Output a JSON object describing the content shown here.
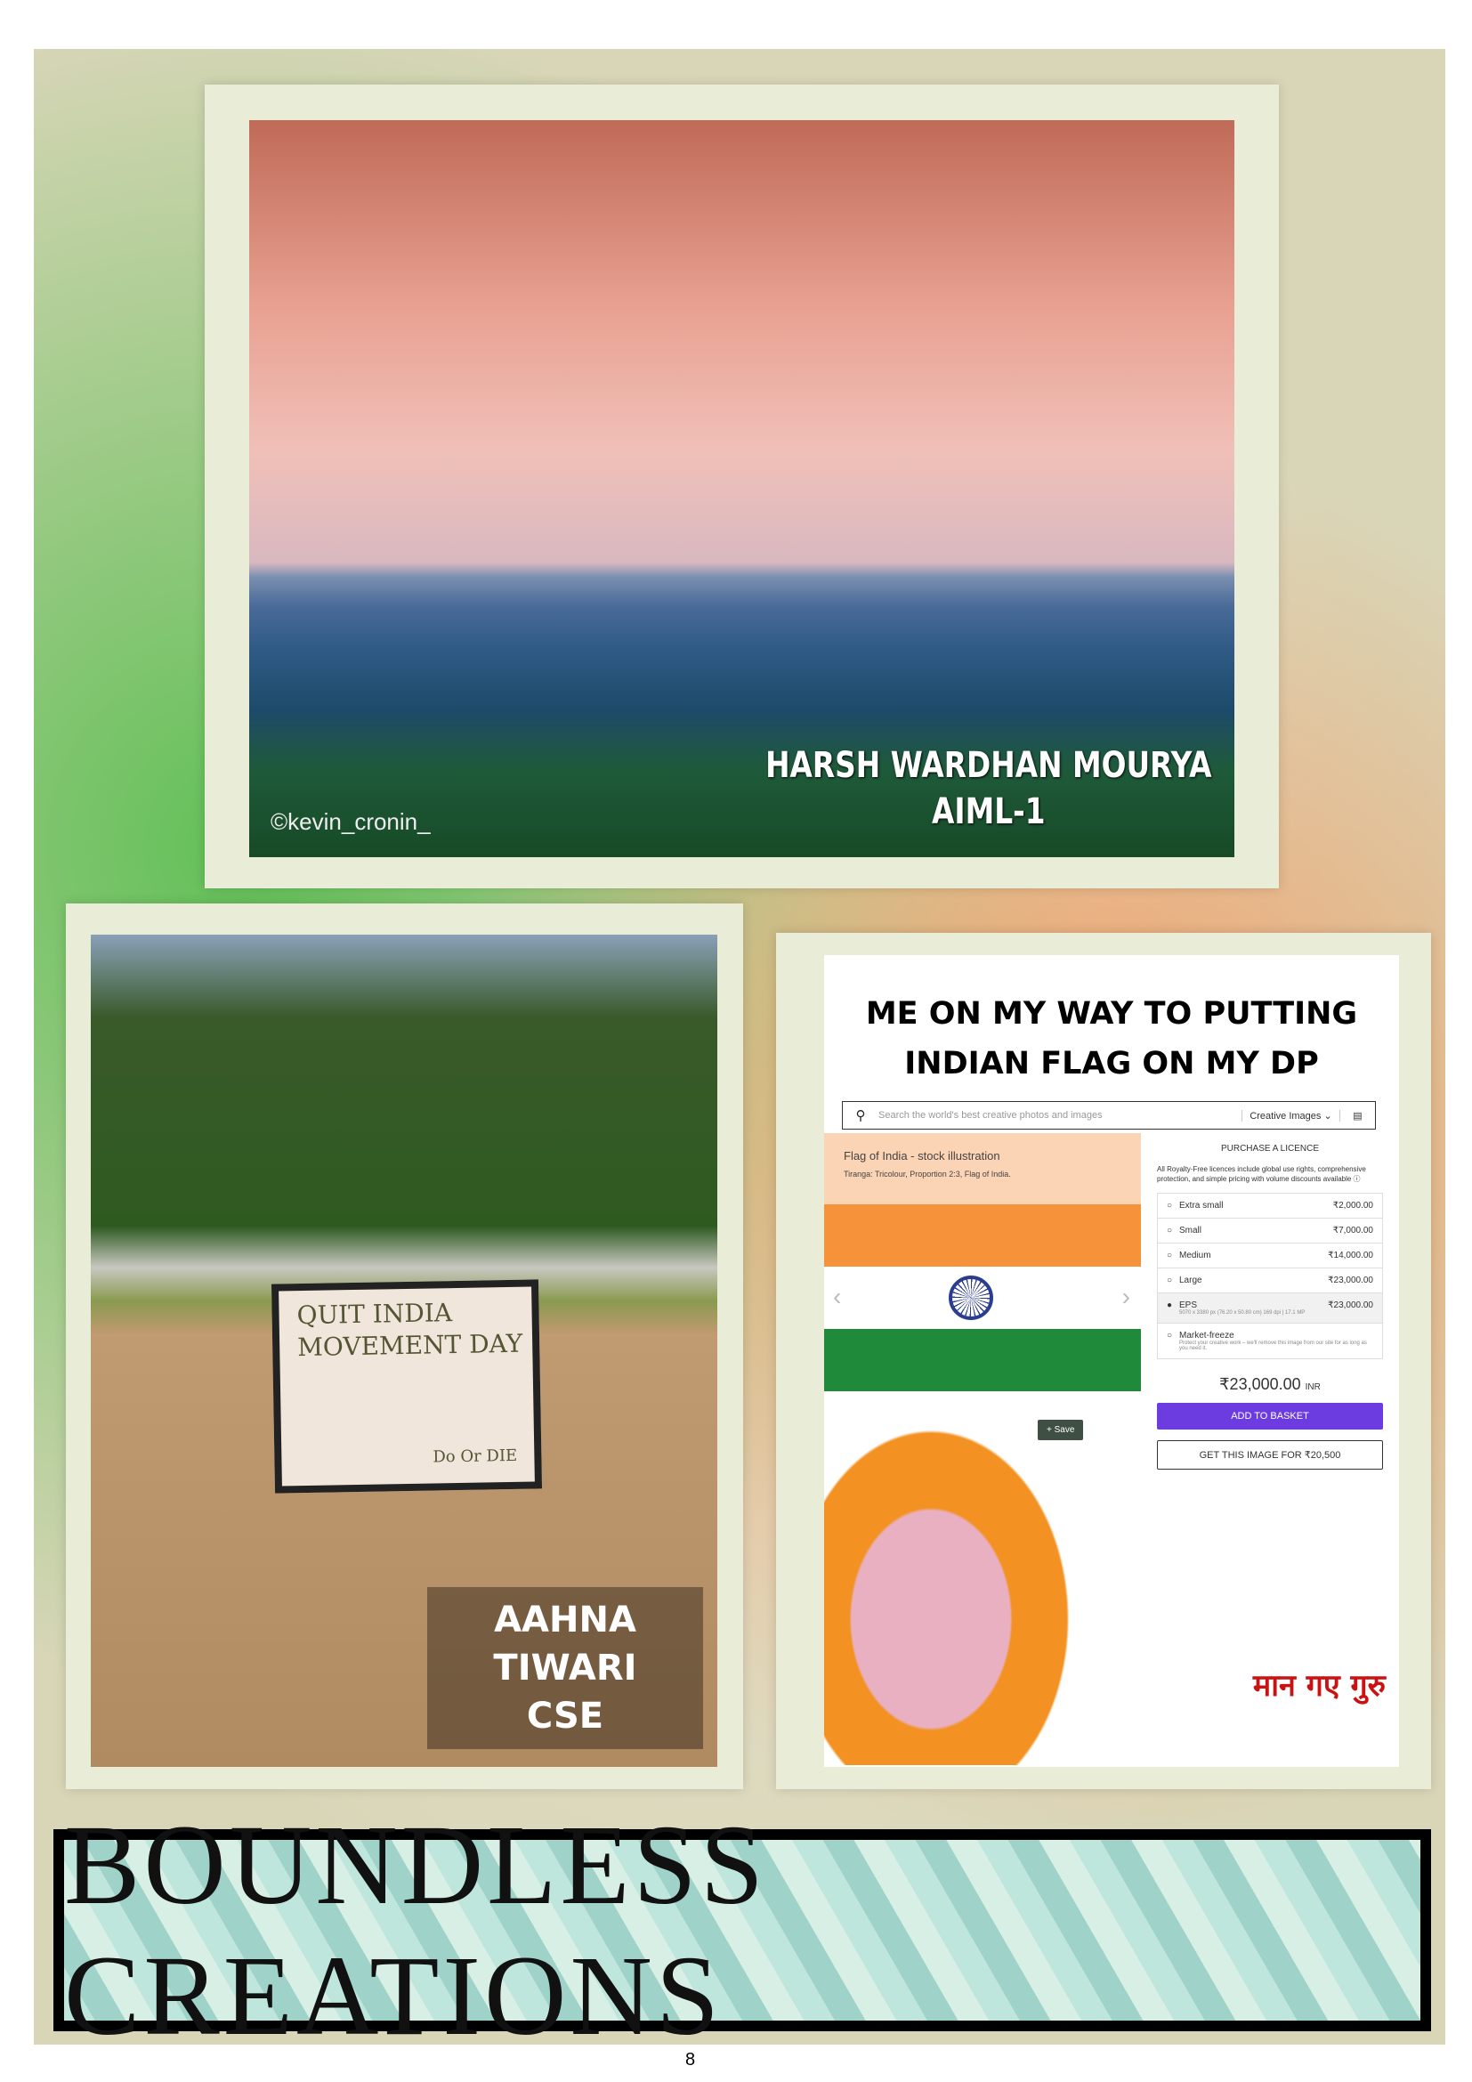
{
  "photo1": {
    "credit": "©kevin_cronin_",
    "author": "HARSH WARDHAN MOURYA",
    "dept": "AIML-1"
  },
  "photo2": {
    "poster_line1": "QUIT INDIA",
    "poster_line2": "MOVEMENT DAY",
    "poster_slogan": "Do Or DIE",
    "author": "AAHNA TIWARI",
    "dept": "CSE"
  },
  "meme": {
    "heading_line1": "ME ON MY WAY TO PUTTING",
    "heading_line2": "INDIAN FLAG ON MY DP",
    "search_placeholder": "Search the world's best creative photos and images",
    "category": "Creative Images ⌄",
    "title": "Flag of India - stock illustration",
    "subtitle": "Tiranga: Tricolour, Proportion 2:3, Flag of India.",
    "save": "+ Save",
    "purchase_title": "PURCHASE A LICENCE",
    "purchase_desc": "All Royalty-Free licences include global use rights, comprehensive protection, and simple pricing with volume discounts available ⓘ",
    "options": [
      {
        "name": "Extra small",
        "price": "₹2,000.00"
      },
      {
        "name": "Small",
        "price": "₹7,000.00"
      },
      {
        "name": "Medium",
        "price": "₹14,000.00"
      },
      {
        "name": "Large",
        "price": "₹23,000.00"
      },
      {
        "name": "EPS",
        "price": "₹23,000.00",
        "detail": "5070 x 3380 px (76.20 x 50.80 cm) 169 dpi | 17.1 MP",
        "selected": true
      },
      {
        "name": "Market-freeze",
        "price": "",
        "detail": "Protect your creative work – we'll remove this image from our site for as long as you need it."
      }
    ],
    "total": "₹23,000.00",
    "currency": "INR",
    "add_to_basket": "ADD TO BASKET",
    "get_image": "GET THIS IMAGE FOR ₹20,500",
    "hindi_caption": "मान गए गुरु"
  },
  "banner": "BOUNDLESS CREATIONS",
  "page_number": "8"
}
